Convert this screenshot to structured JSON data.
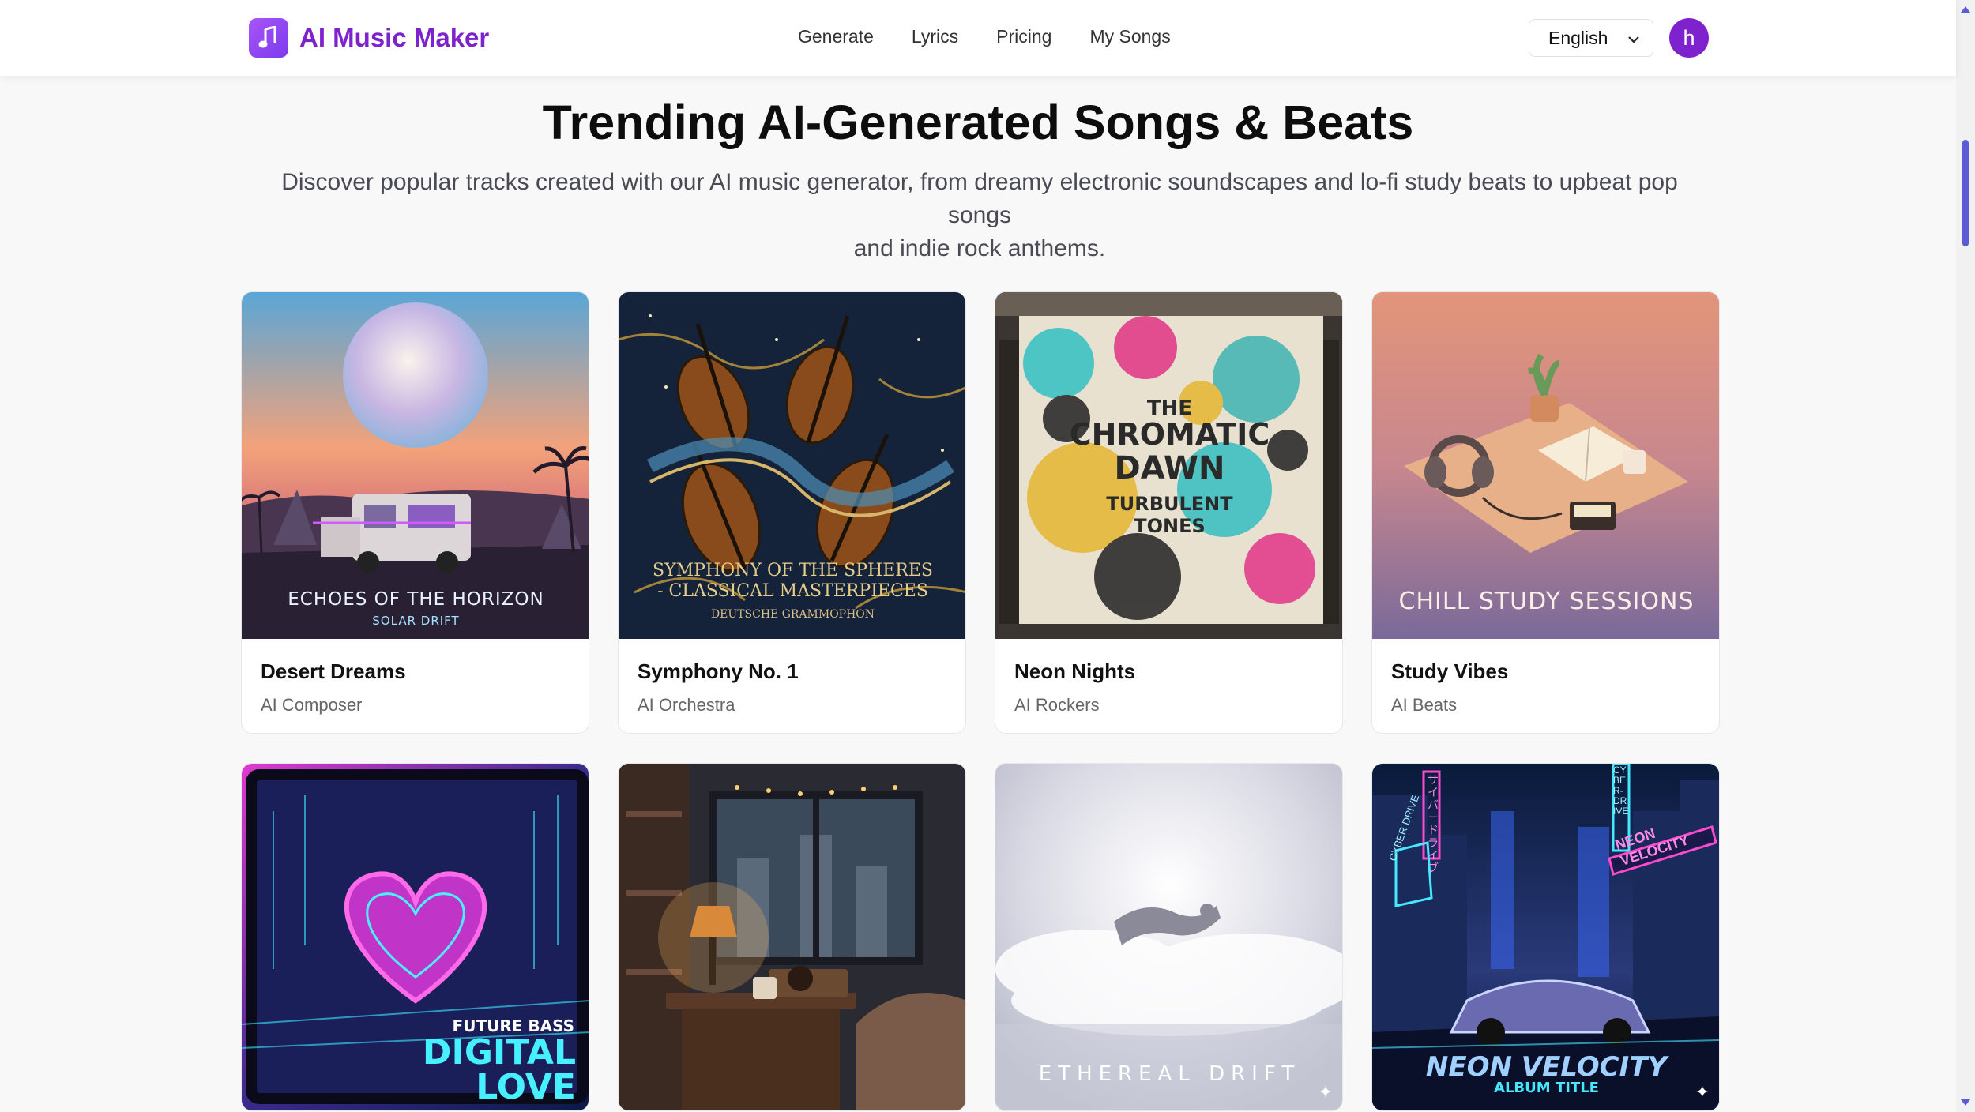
{
  "header": {
    "logo_text": "AI Music Maker",
    "nav": [
      "Generate",
      "Lyrics",
      "Pricing",
      "My Songs"
    ],
    "language": "English",
    "avatar_initial": "h"
  },
  "hero": {
    "title": "Trending AI-Generated Songs & Beats",
    "subtitle_line1": "Discover popular tracks created with our AI music generator, from dreamy electronic soundscapes and lo-fi study beats to upbeat pop songs",
    "subtitle_line2": "and indie rock anthems."
  },
  "songs": [
    {
      "title": "Desert Dreams",
      "artist": "AI Composer",
      "cover_line1": "ECHOES OF THE HORIZON",
      "cover_line2": "SOLAR DRIFT"
    },
    {
      "title": "Symphony No. 1",
      "artist": "AI Orchestra",
      "cover_line1": "SYMPHONY OF THE SPHERES",
      "cover_line2": "- CLASSICAL MASTERPIECES",
      "cover_line3": "DEUTSCHE GRAMMOPHON"
    },
    {
      "title": "Neon Nights",
      "artist": "AI Rockers",
      "cover_line1": "THE",
      "cover_line2": "CHROMATIC",
      "cover_line3": "DAWN",
      "cover_line4": "TURBULENT",
      "cover_line5": "TONES"
    },
    {
      "title": "Study Vibes",
      "artist": "AI Beats",
      "cover_line1": "CHILL STUDY SESSIONS"
    },
    {
      "cover_line1": "FUTURE BASS",
      "cover_line2": "DIGITAL",
      "cover_line3": "LOVE"
    },
    {},
    {
      "cover_line1": "ETHEREAL DRIFT"
    },
    {
      "cover_line1": "NEON VELOCITY",
      "cover_line2": "ALBUM TITLE",
      "cover_sign1": "NEON VELOCITY",
      "cover_sign2": "CYBER-DRIVE",
      "cover_sign3": "CYBER DRIVE",
      "cover_sign4": "サイバードライブ"
    }
  ],
  "colors": {
    "brand": "#7e22ce",
    "scrollbar": "#5b5bd6"
  }
}
